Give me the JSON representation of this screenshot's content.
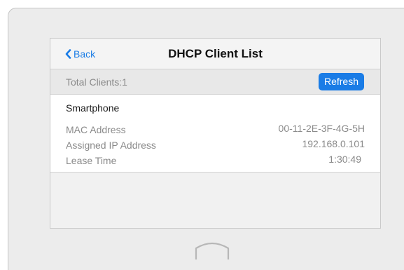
{
  "nav": {
    "back_label": "Back",
    "title": "DHCP Client List"
  },
  "summary": {
    "total_clients": "Total Clients:1",
    "refresh_label": "Refresh"
  },
  "client": {
    "name": "Smartphone",
    "fields": [
      {
        "label": "MAC Address",
        "value": "00-11-2E-3F-4G-5H"
      },
      {
        "label": "Assigned IP Address",
        "value": "192.168.0.101"
      },
      {
        "label": "Lease Time",
        "value": "1:30:49"
      }
    ]
  },
  "icons": {
    "back": "chevron-left-icon",
    "home": "home-button-icon"
  },
  "colors": {
    "accent": "#1a7ce6",
    "device_bg": "#ececec",
    "screen_bg": "#f1f1f1",
    "card_bg": "#ffffff",
    "muted_text": "#8a8a8a"
  }
}
